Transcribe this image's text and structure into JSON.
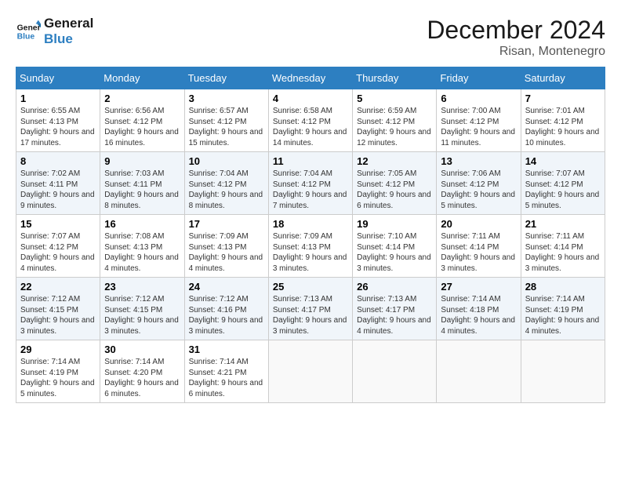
{
  "logo": {
    "line1": "General",
    "line2": "Blue"
  },
  "header": {
    "month": "December 2024",
    "location": "Risan, Montenegro"
  },
  "weekdays": [
    "Sunday",
    "Monday",
    "Tuesday",
    "Wednesday",
    "Thursday",
    "Friday",
    "Saturday"
  ],
  "weeks": [
    [
      {
        "day": "1",
        "sunrise": "6:55 AM",
        "sunset": "4:13 PM",
        "daylight": "9 hours and 17 minutes."
      },
      {
        "day": "2",
        "sunrise": "6:56 AM",
        "sunset": "4:12 PM",
        "daylight": "9 hours and 16 minutes."
      },
      {
        "day": "3",
        "sunrise": "6:57 AM",
        "sunset": "4:12 PM",
        "daylight": "9 hours and 15 minutes."
      },
      {
        "day": "4",
        "sunrise": "6:58 AM",
        "sunset": "4:12 PM",
        "daylight": "9 hours and 14 minutes."
      },
      {
        "day": "5",
        "sunrise": "6:59 AM",
        "sunset": "4:12 PM",
        "daylight": "9 hours and 12 minutes."
      },
      {
        "day": "6",
        "sunrise": "7:00 AM",
        "sunset": "4:12 PM",
        "daylight": "9 hours and 11 minutes."
      },
      {
        "day": "7",
        "sunrise": "7:01 AM",
        "sunset": "4:12 PM",
        "daylight": "9 hours and 10 minutes."
      }
    ],
    [
      {
        "day": "8",
        "sunrise": "7:02 AM",
        "sunset": "4:11 PM",
        "daylight": "9 hours and 9 minutes."
      },
      {
        "day": "9",
        "sunrise": "7:03 AM",
        "sunset": "4:11 PM",
        "daylight": "9 hours and 8 minutes."
      },
      {
        "day": "10",
        "sunrise": "7:04 AM",
        "sunset": "4:12 PM",
        "daylight": "9 hours and 8 minutes."
      },
      {
        "day": "11",
        "sunrise": "7:04 AM",
        "sunset": "4:12 PM",
        "daylight": "9 hours and 7 minutes."
      },
      {
        "day": "12",
        "sunrise": "7:05 AM",
        "sunset": "4:12 PM",
        "daylight": "9 hours and 6 minutes."
      },
      {
        "day": "13",
        "sunrise": "7:06 AM",
        "sunset": "4:12 PM",
        "daylight": "9 hours and 5 minutes."
      },
      {
        "day": "14",
        "sunrise": "7:07 AM",
        "sunset": "4:12 PM",
        "daylight": "9 hours and 5 minutes."
      }
    ],
    [
      {
        "day": "15",
        "sunrise": "7:07 AM",
        "sunset": "4:12 PM",
        "daylight": "9 hours and 4 minutes."
      },
      {
        "day": "16",
        "sunrise": "7:08 AM",
        "sunset": "4:13 PM",
        "daylight": "9 hours and 4 minutes."
      },
      {
        "day": "17",
        "sunrise": "7:09 AM",
        "sunset": "4:13 PM",
        "daylight": "9 hours and 4 minutes."
      },
      {
        "day": "18",
        "sunrise": "7:09 AM",
        "sunset": "4:13 PM",
        "daylight": "9 hours and 3 minutes."
      },
      {
        "day": "19",
        "sunrise": "7:10 AM",
        "sunset": "4:14 PM",
        "daylight": "9 hours and 3 minutes."
      },
      {
        "day": "20",
        "sunrise": "7:11 AM",
        "sunset": "4:14 PM",
        "daylight": "9 hours and 3 minutes."
      },
      {
        "day": "21",
        "sunrise": "7:11 AM",
        "sunset": "4:14 PM",
        "daylight": "9 hours and 3 minutes."
      }
    ],
    [
      {
        "day": "22",
        "sunrise": "7:12 AM",
        "sunset": "4:15 PM",
        "daylight": "9 hours and 3 minutes."
      },
      {
        "day": "23",
        "sunrise": "7:12 AM",
        "sunset": "4:15 PM",
        "daylight": "9 hours and 3 minutes."
      },
      {
        "day": "24",
        "sunrise": "7:12 AM",
        "sunset": "4:16 PM",
        "daylight": "9 hours and 3 minutes."
      },
      {
        "day": "25",
        "sunrise": "7:13 AM",
        "sunset": "4:17 PM",
        "daylight": "9 hours and 3 minutes."
      },
      {
        "day": "26",
        "sunrise": "7:13 AM",
        "sunset": "4:17 PM",
        "daylight": "9 hours and 4 minutes."
      },
      {
        "day": "27",
        "sunrise": "7:14 AM",
        "sunset": "4:18 PM",
        "daylight": "9 hours and 4 minutes."
      },
      {
        "day": "28",
        "sunrise": "7:14 AM",
        "sunset": "4:19 PM",
        "daylight": "9 hours and 4 minutes."
      }
    ],
    [
      {
        "day": "29",
        "sunrise": "7:14 AM",
        "sunset": "4:19 PM",
        "daylight": "9 hours and 5 minutes."
      },
      {
        "day": "30",
        "sunrise": "7:14 AM",
        "sunset": "4:20 PM",
        "daylight": "9 hours and 6 minutes."
      },
      {
        "day": "31",
        "sunrise": "7:14 AM",
        "sunset": "4:21 PM",
        "daylight": "9 hours and 6 minutes."
      },
      null,
      null,
      null,
      null
    ]
  ]
}
